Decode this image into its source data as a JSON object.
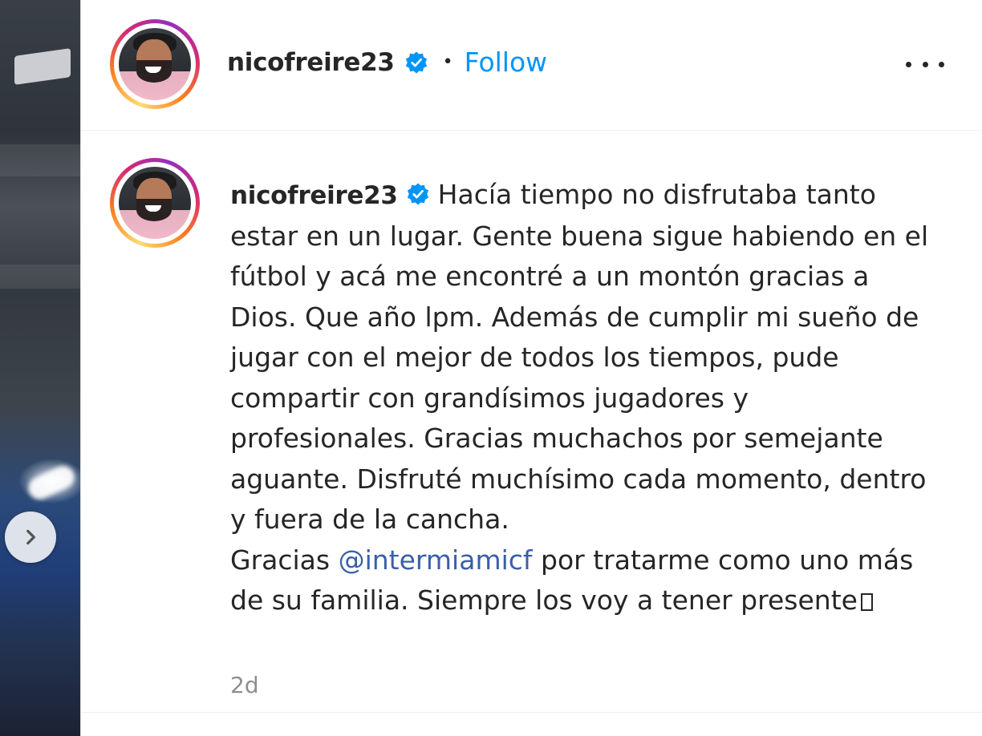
{
  "post": {
    "username": "nicofreire23",
    "separator": "•",
    "follow_label": "Follow",
    "more_icon": "more-horizontal-icon",
    "next_icon": "chevron-right-icon"
  },
  "caption": {
    "username": "nicofreire23",
    "text_before_mention": "Hacía tiempo no disfrutaba tanto estar en un lugar. Gente buena sigue habiendo en el fútbol y acá me encontré a un montón gracias a Dios. Que año lpm. Además de cumplir mi sueño de jugar con el mejor de todos los tiempos, pude compartir con grandísimos jugadores y profesionales. Gracias muchachos por semejante aguante. Disfruté muchísimo cada momento, dentro y fuera de la cancha.",
    "gracias_prefix": "Gracias",
    "mention": "@intermiamicf",
    "text_after_mention": "por tratarme como uno más de su familia. Siempre los voy a tener presente",
    "timestamp": "2d"
  },
  "colors": {
    "link_blue": "#0095f6",
    "verified_blue": "#0095f6",
    "text": "#262626",
    "muted": "#8e8e8e",
    "mention": "#3a5fa8"
  }
}
